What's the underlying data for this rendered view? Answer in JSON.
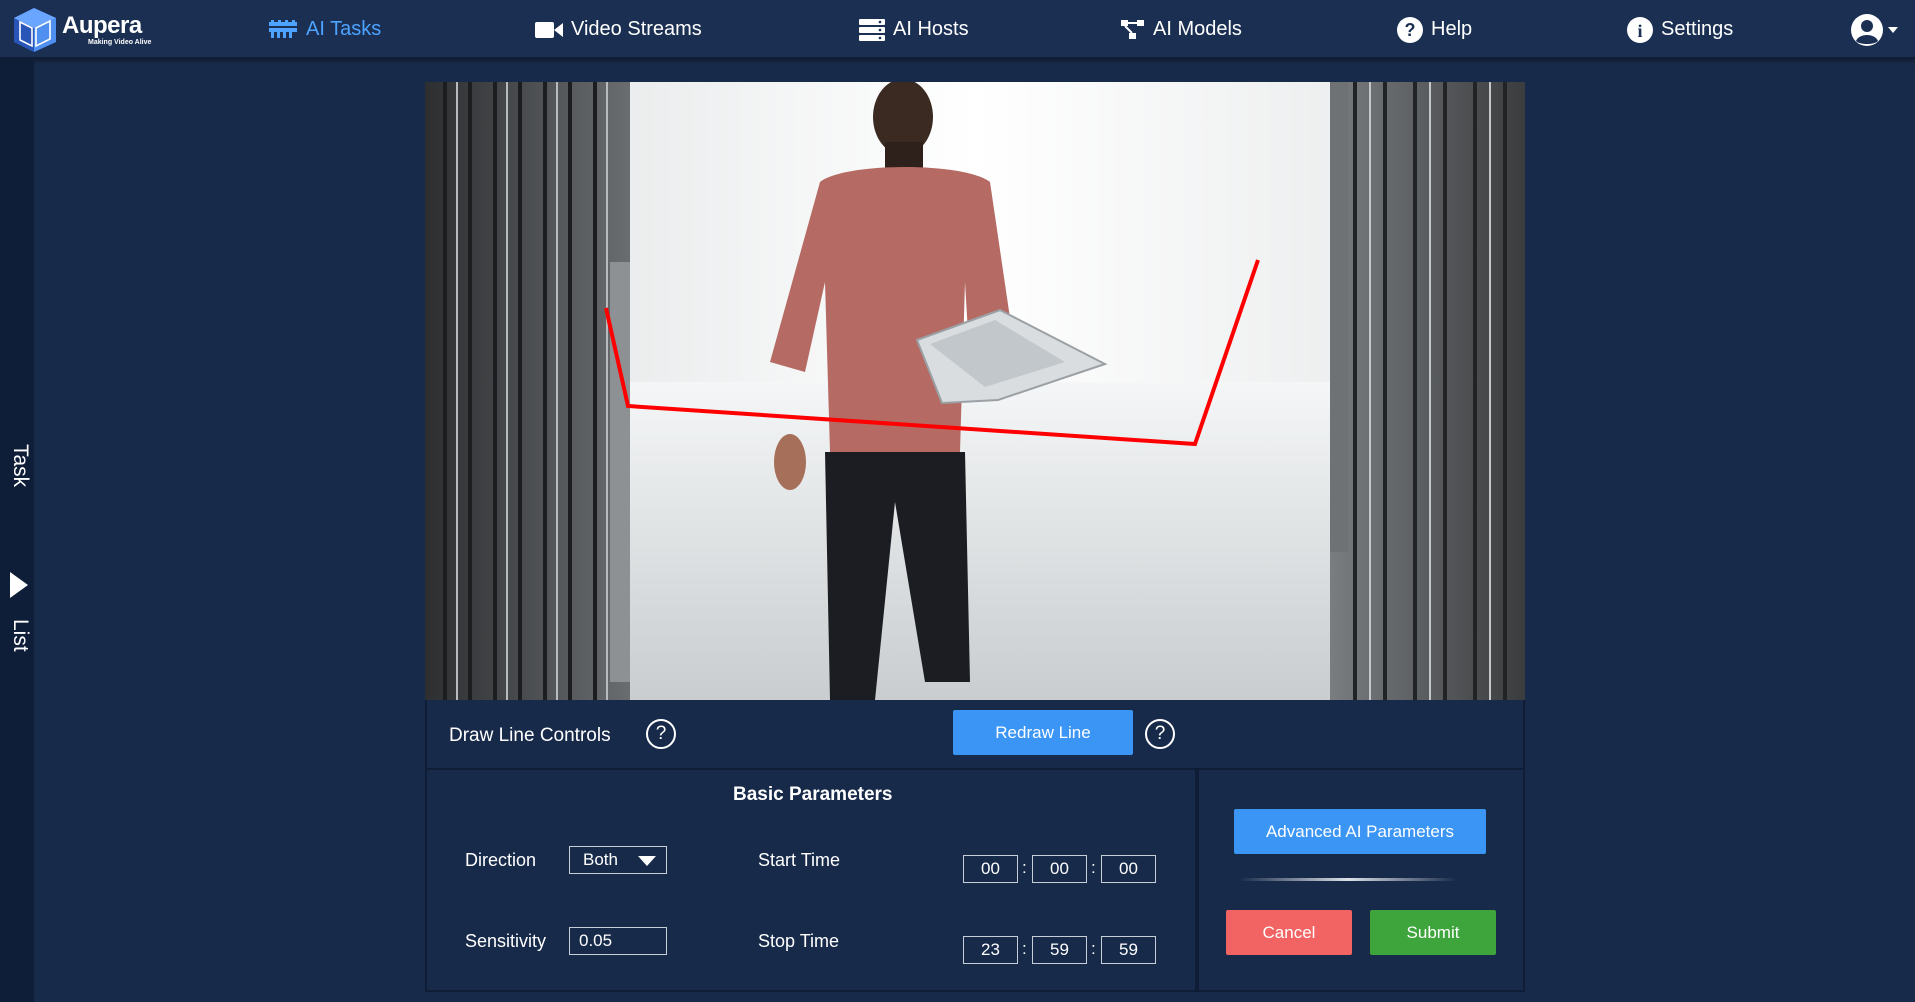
{
  "brand": {
    "name": "Aupera",
    "tagline": "Making Video Alive"
  },
  "nav": {
    "items": [
      {
        "label": "AI Tasks",
        "icon": "tasks-icon",
        "active": true
      },
      {
        "label": "Video Streams",
        "icon": "video-camera-icon",
        "active": false
      },
      {
        "label": "AI Hosts",
        "icon": "server-icon",
        "active": false
      },
      {
        "label": "AI Models",
        "icon": "model-network-icon",
        "active": false
      },
      {
        "label": "Help",
        "icon": "question-circle-icon",
        "active": false
      },
      {
        "label": "Settings",
        "icon": "info-circle-icon",
        "active": false
      }
    ],
    "user_icon": "user-avatar-icon"
  },
  "side_tab": {
    "label_top": "Task",
    "label_bottom": "List"
  },
  "draw_controls": {
    "title": "Draw Line Controls",
    "redraw_label": "Redraw Line",
    "help_glyph": "?",
    "line_color": "#ff0000"
  },
  "basic_params": {
    "title": "Basic Parameters",
    "direction_label": "Direction",
    "direction_value": "Both",
    "sensitivity_label": "Sensitivity",
    "sensitivity_value": "0.05",
    "start_time_label": "Start Time",
    "start_time": {
      "h": "00",
      "m": "00",
      "s": "00"
    },
    "stop_time_label": "Stop Time",
    "stop_time": {
      "h": "23",
      "m": "59",
      "s": "59"
    },
    "separator": ":"
  },
  "actions": {
    "advanced_label": "Advanced AI Parameters",
    "cancel_label": "Cancel",
    "submit_label": "Submit"
  },
  "colors": {
    "background": "#182a4a",
    "nav_background": "#1a2f52",
    "accent": "#4da3ff",
    "primary_button": "#3a95f4",
    "cancel_button": "#f26363",
    "submit_button": "#3ea43c"
  }
}
